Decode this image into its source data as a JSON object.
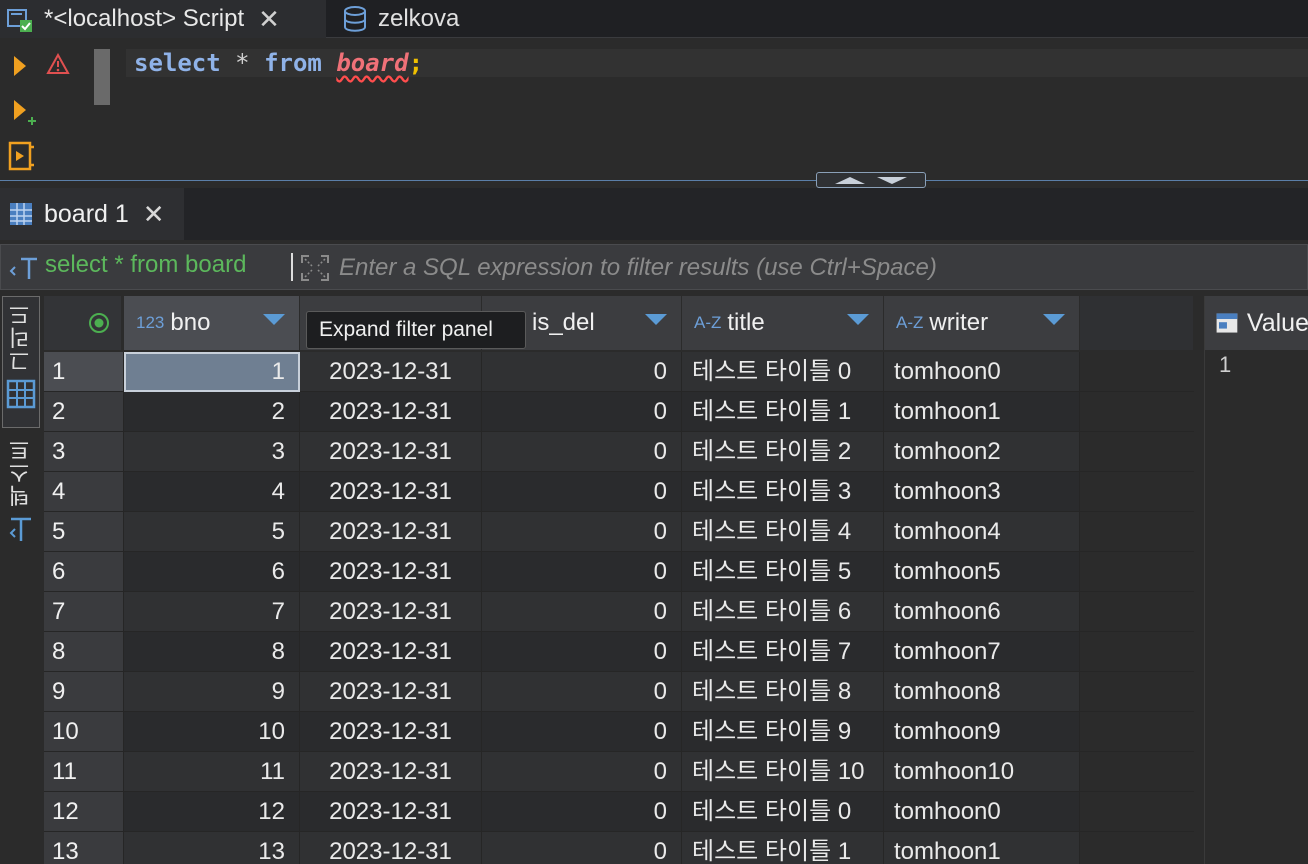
{
  "editor_tabs": [
    {
      "label": "*<localhost> Script",
      "icon": "sql-script-icon",
      "closable": true,
      "active": true
    },
    {
      "label": "zelkova",
      "icon": "database-icon",
      "closable": false,
      "active": false
    }
  ],
  "editor": {
    "keyword_select": "select",
    "star": "*",
    "keyword_from": "from",
    "table_name": "board",
    "semicolon": ";"
  },
  "result_tab": {
    "label": "board 1",
    "icon": "table-grid-icon"
  },
  "filter": {
    "query": "select * from board",
    "placeholder": "Enter a SQL expression to filter results (use Ctrl+Space)"
  },
  "view_modes": {
    "grid": "그리드",
    "text": "텍스트"
  },
  "columns": [
    {
      "key": "bno",
      "label": "bno",
      "type_icon": "123"
    },
    {
      "key": "date",
      "label": "",
      "type_icon": ""
    },
    {
      "key": "is_del",
      "label": "is_del",
      "type_icon": ""
    },
    {
      "key": "title",
      "label": "title",
      "type_icon": "A-Z"
    },
    {
      "key": "writer",
      "label": "writer",
      "type_icon": "A-Z"
    }
  ],
  "tooltip": "Expand filter panel",
  "rows": [
    {
      "n": "1",
      "bno": "1",
      "date": "2023-12-31",
      "is_del": "0",
      "title": "테스트 타이틀 0",
      "writer": "tomhoon0"
    },
    {
      "n": "2",
      "bno": "2",
      "date": "2023-12-31",
      "is_del": "0",
      "title": "테스트 타이틀 1",
      "writer": "tomhoon1"
    },
    {
      "n": "3",
      "bno": "3",
      "date": "2023-12-31",
      "is_del": "0",
      "title": "테스트 타이틀 2",
      "writer": "tomhoon2"
    },
    {
      "n": "4",
      "bno": "4",
      "date": "2023-12-31",
      "is_del": "0",
      "title": "테스트 타이틀 3",
      "writer": "tomhoon3"
    },
    {
      "n": "5",
      "bno": "5",
      "date": "2023-12-31",
      "is_del": "0",
      "title": "테스트 타이틀 4",
      "writer": "tomhoon4"
    },
    {
      "n": "6",
      "bno": "6",
      "date": "2023-12-31",
      "is_del": "0",
      "title": "테스트 타이틀 5",
      "writer": "tomhoon5"
    },
    {
      "n": "7",
      "bno": "7",
      "date": "2023-12-31",
      "is_del": "0",
      "title": "테스트 타이틀 6",
      "writer": "tomhoon6"
    },
    {
      "n": "8",
      "bno": "8",
      "date": "2023-12-31",
      "is_del": "0",
      "title": "테스트 타이틀 7",
      "writer": "tomhoon7"
    },
    {
      "n": "9",
      "bno": "9",
      "date": "2023-12-31",
      "is_del": "0",
      "title": "테스트 타이틀 8",
      "writer": "tomhoon8"
    },
    {
      "n": "10",
      "bno": "10",
      "date": "2023-12-31",
      "is_del": "0",
      "title": "테스트 타이틀 9",
      "writer": "tomhoon9"
    },
    {
      "n": "11",
      "bno": "11",
      "date": "2023-12-31",
      "is_del": "0",
      "title": "테스트 타이틀 10",
      "writer": "tomhoon10"
    },
    {
      "n": "12",
      "bno": "12",
      "date": "2023-12-31",
      "is_del": "0",
      "title": "테스트 타이틀 0",
      "writer": "tomhoon0"
    },
    {
      "n": "13",
      "bno": "13",
      "date": "2023-12-31",
      "is_del": "0",
      "title": "테스트 타이틀 1",
      "writer": "tomhoon1"
    }
  ],
  "value_panel": {
    "title": "Value",
    "content": "1"
  },
  "colors": {
    "keyword": "#8fb2e8",
    "table": "#f07178",
    "filter_query": "#5cb85c",
    "accent": "#5b9bd5"
  }
}
